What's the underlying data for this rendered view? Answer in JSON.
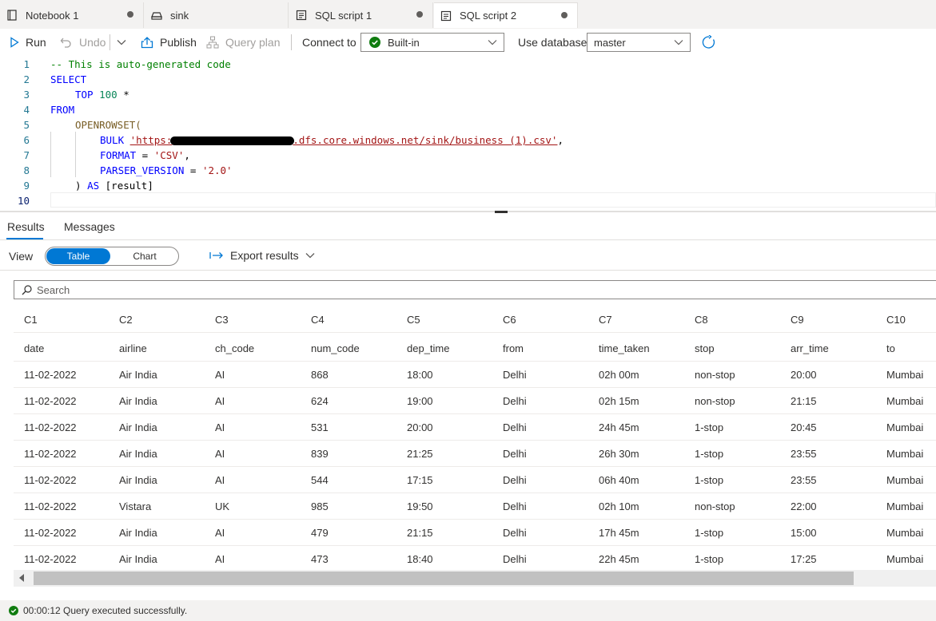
{
  "tabs": [
    {
      "label": "Notebook 1",
      "icon": "notebook-icon",
      "unsaved": true
    },
    {
      "label": "sink",
      "icon": "storage-icon",
      "unsaved": false
    },
    {
      "label": "SQL script 1",
      "icon": "sql-script-icon",
      "unsaved": true
    },
    {
      "label": "SQL script 2",
      "icon": "sql-script-icon",
      "unsaved": true,
      "active": true
    }
  ],
  "toolbar": {
    "run": "Run",
    "undo": "Undo",
    "publish": "Publish",
    "query_plan": "Query plan",
    "connect_to_label": "Connect to",
    "connect_to_value": "Built-in",
    "use_database_label": "Use database",
    "use_database_value": "master"
  },
  "editor": {
    "line_numbers": [
      "1",
      "2",
      "3",
      "4",
      "5",
      "6",
      "7",
      "8",
      "9",
      "10"
    ],
    "lines": {
      "l1": "-- This is auto-generated code",
      "l2": "SELECT",
      "l3_kw": "TOP",
      "l3_num": "100",
      "l3_rest": " *",
      "l4": "FROM",
      "l5": "OPENROWSET(",
      "l6_kw": "BULK ",
      "l6_str_start": "'https:",
      "l6_str_end": ".dfs.core.windows.net/sink/business (1).csv'",
      "l6_comma": ",",
      "l7_kw": "FORMAT",
      "l7_eq": " = ",
      "l7_str": "'CSV'",
      "l7_comma": ",",
      "l8_kw": "PARSER_VERSION",
      "l8_eq": " = ",
      "l8_str": "'2.0'",
      "l9_paren": ") ",
      "l9_kw": "AS",
      "l9_rest": " [result]"
    }
  },
  "results": {
    "tabs": [
      "Results",
      "Messages"
    ],
    "view_label": "View",
    "view_options": [
      "Table",
      "Chart"
    ],
    "export_label": "Export results",
    "search_placeholder": "Search",
    "columns": [
      "C1",
      "C2",
      "C3",
      "C4",
      "C5",
      "C6",
      "C7",
      "C8",
      "C9",
      "C10"
    ],
    "rows": [
      [
        "date",
        "airline",
        "ch_code",
        "num_code",
        "dep_time",
        "from",
        "time_taken",
        "stop",
        "arr_time",
        "to"
      ],
      [
        "11-02-2022",
        "Air India",
        "AI",
        "868",
        "18:00",
        "Delhi",
        "02h 00m",
        "non-stop",
        "20:00",
        "Mumbai"
      ],
      [
        "11-02-2022",
        "Air India",
        "AI",
        "624",
        "19:00",
        "Delhi",
        "02h 15m",
        "non-stop",
        "21:15",
        "Mumbai"
      ],
      [
        "11-02-2022",
        "Air India",
        "AI",
        "531",
        "20:00",
        "Delhi",
        "24h 45m",
        "1-stop",
        "20:45",
        "Mumbai"
      ],
      [
        "11-02-2022",
        "Air India",
        "AI",
        "839",
        "21:25",
        "Delhi",
        "26h 30m",
        "1-stop",
        "23:55",
        "Mumbai"
      ],
      [
        "11-02-2022",
        "Air India",
        "AI",
        "544",
        "17:15",
        "Delhi",
        "06h 40m",
        "1-stop",
        "23:55",
        "Mumbai"
      ],
      [
        "11-02-2022",
        "Vistara",
        "UK",
        "985",
        "19:50",
        "Delhi",
        "02h 10m",
        "non-stop",
        "22:00",
        "Mumbai"
      ],
      [
        "11-02-2022",
        "Air India",
        "AI",
        "479",
        "21:15",
        "Delhi",
        "17h 45m",
        "1-stop",
        "15:00",
        "Mumbai"
      ],
      [
        "11-02-2022",
        "Air India",
        "AI",
        "473",
        "18:40",
        "Delhi",
        "22h 45m",
        "1-stop",
        "17:25",
        "Mumbai"
      ]
    ]
  },
  "status": {
    "text": "00:00:12 Query executed successfully."
  },
  "colors": {
    "accent": "#0078d4",
    "success": "#107c10"
  }
}
